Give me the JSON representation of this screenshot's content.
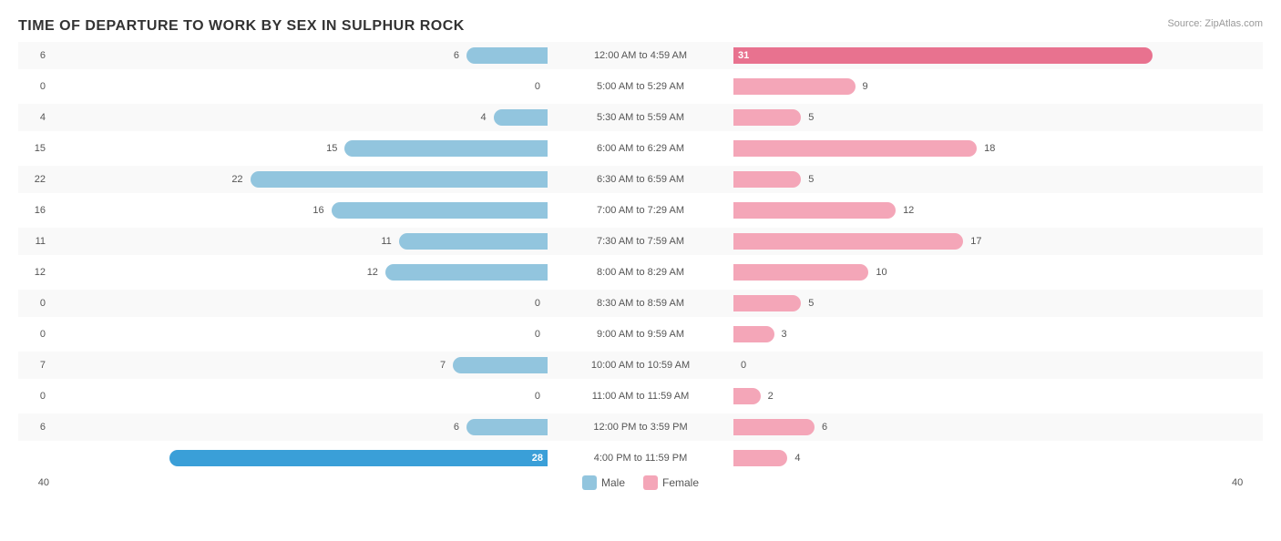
{
  "title": "TIME OF DEPARTURE TO WORK BY SEX IN SULPHUR ROCK",
  "source": "Source: ZipAtlas.com",
  "legend": {
    "male_label": "Male",
    "female_label": "Female",
    "male_color": "#92c5de",
    "female_color": "#f4a6b8"
  },
  "axis": {
    "left": "40",
    "right": "40"
  },
  "max_value": 31,
  "bar_scale": 460,
  "rows": [
    {
      "label": "12:00 AM to 4:59 AM",
      "male": 6,
      "female": 31,
      "female_highlight": true
    },
    {
      "label": "5:00 AM to 5:29 AM",
      "male": 0,
      "female": 9
    },
    {
      "label": "5:30 AM to 5:59 AM",
      "male": 4,
      "female": 5
    },
    {
      "label": "6:00 AM to 6:29 AM",
      "male": 15,
      "female": 18
    },
    {
      "label": "6:30 AM to 6:59 AM",
      "male": 22,
      "female": 5
    },
    {
      "label": "7:00 AM to 7:29 AM",
      "male": 16,
      "female": 12
    },
    {
      "label": "7:30 AM to 7:59 AM",
      "male": 11,
      "female": 17
    },
    {
      "label": "8:00 AM to 8:29 AM",
      "male": 12,
      "female": 10
    },
    {
      "label": "8:30 AM to 8:59 AM",
      "male": 0,
      "female": 5
    },
    {
      "label": "9:00 AM to 9:59 AM",
      "male": 0,
      "female": 3
    },
    {
      "label": "10:00 AM to 10:59 AM",
      "male": 7,
      "female": 0
    },
    {
      "label": "11:00 AM to 11:59 AM",
      "male": 0,
      "female": 2
    },
    {
      "label": "12:00 PM to 3:59 PM",
      "male": 6,
      "female": 6
    },
    {
      "label": "4:00 PM to 11:59 PM",
      "male": 28,
      "female": 4,
      "male_highlight": true
    }
  ]
}
